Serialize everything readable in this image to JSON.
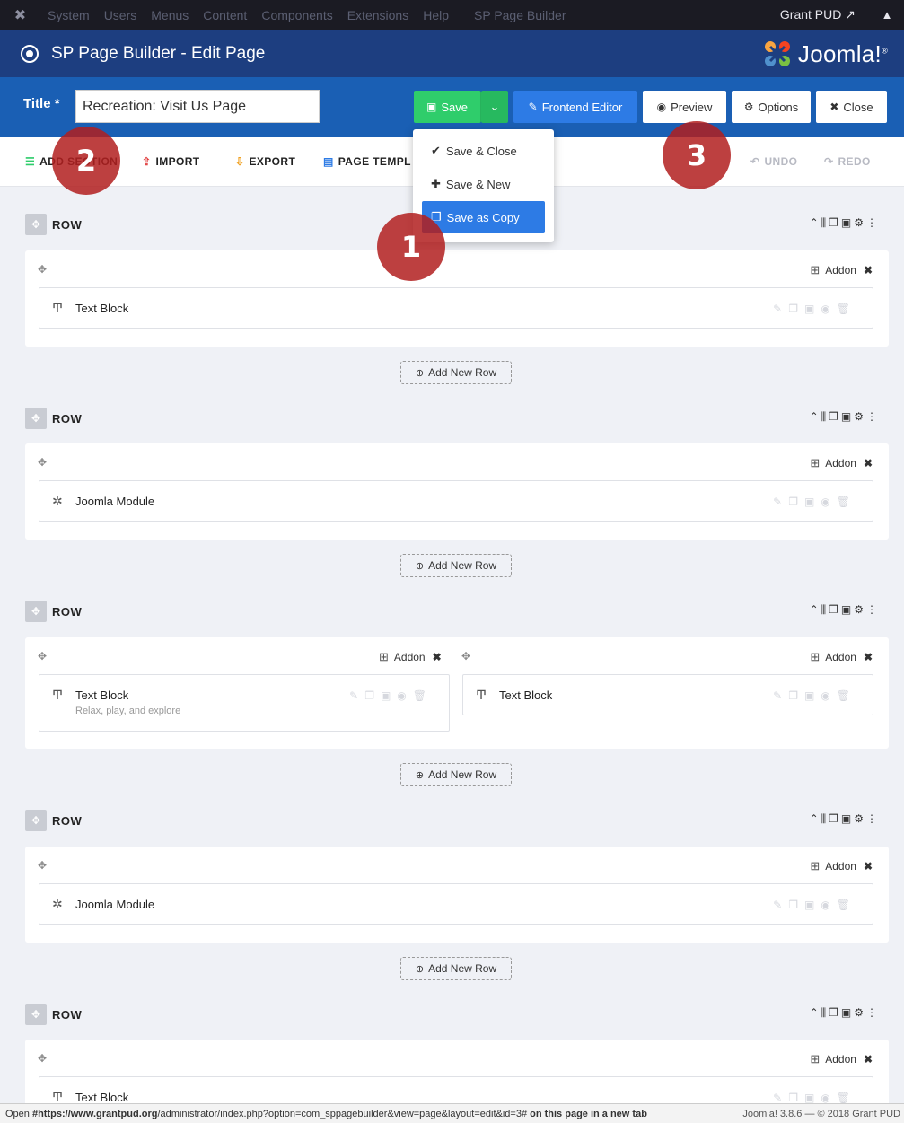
{
  "topbar": {
    "menus": [
      "System",
      "Users",
      "Menus",
      "Content",
      "Components",
      "Extensions",
      "Help"
    ],
    "sp_menu": "SP Page Builder",
    "user": "Grant PUD",
    "external_icon": "external-link-icon",
    "person_icon": "user-icon"
  },
  "header": {
    "title": "SP Page Builder - Edit Page",
    "logo_text": "Joomla!",
    "logo_mark": "®"
  },
  "toolbar": {
    "title_label": "Title *",
    "title_value": "Recreation: Visit Us Page",
    "save": "Save",
    "frontend_editor": "Frontend Editor",
    "preview": "Preview",
    "options": "Options",
    "close": "Close"
  },
  "save_menu": {
    "save_close": "Save & Close",
    "save_new": "Save & New",
    "save_copy": "Save as Copy"
  },
  "builder_toolbar": {
    "add_section": "ADD SECTION",
    "import": "IMPORT",
    "export": "EXPORT",
    "page_templates": "PAGE TEMPL",
    "undo": "UNDO",
    "redo": "REDO"
  },
  "callouts": [
    "1",
    "2",
    "3"
  ],
  "row_label": "ROW",
  "addon_label": "Addon",
  "add_new_row": "Add New Row",
  "rows": [
    {
      "addons": [
        {
          "name": "Text Block"
        }
      ]
    },
    {
      "addons": [
        {
          "name": "Joomla Module"
        }
      ]
    },
    {
      "addons": [
        {
          "name": "Text Block",
          "subtitle": "Relax, play, and explore"
        },
        {
          "name": "Text Block"
        }
      ]
    },
    {
      "addons": [
        {
          "name": "Joomla Module"
        }
      ]
    },
    {
      "addons": [
        {
          "name": "Text Block"
        }
      ]
    }
  ],
  "statusbar": {
    "prefix": "Open ",
    "url_bold": "#https://www.grantpud.org",
    "url_rest": "/administrator/index.php?option=com_sppagebuilder&view=page&layout=edit&id=3#",
    "suffix": " on this page in a new tab",
    "version": "Joomla! 3.8.6  —  © 2018 Grant PUD"
  },
  "colors": {
    "topbar": "#1b1b23",
    "header": "#1d3e80",
    "toolbar": "#1a5fb4",
    "save_green": "#2fcd6b",
    "primary_blue": "#2d7be5",
    "callout_red": "#b21e1e"
  }
}
